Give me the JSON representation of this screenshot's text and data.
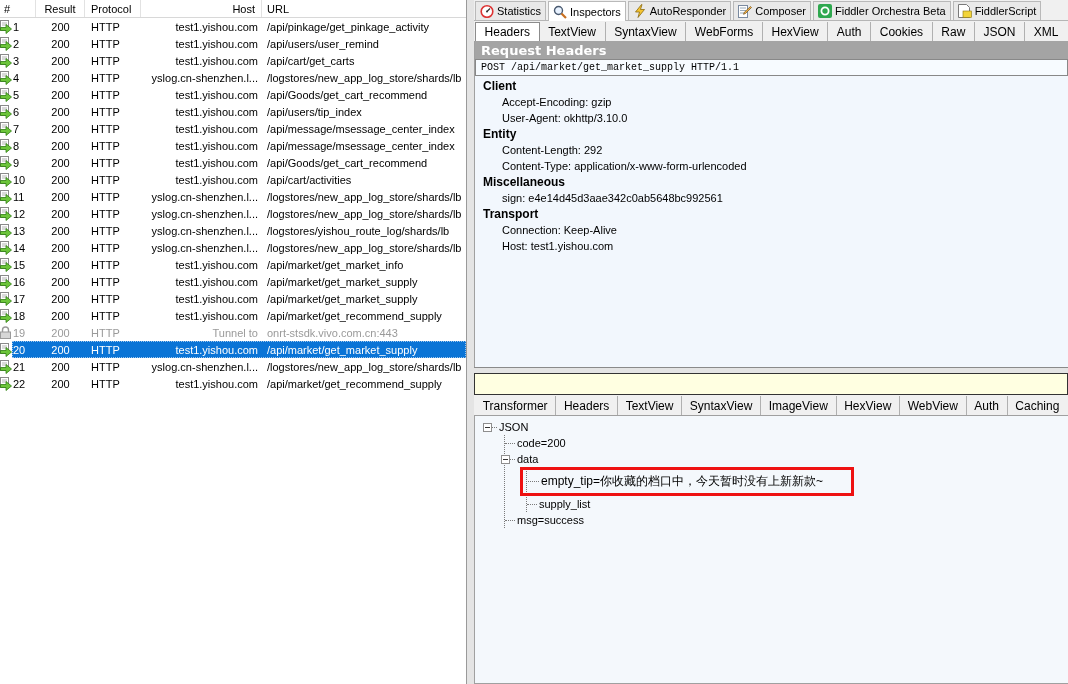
{
  "sessions": {
    "columns": [
      "#",
      "Result",
      "Protocol",
      "Host",
      "URL"
    ],
    "rows": [
      {
        "number": "1",
        "result": "200",
        "protocol": "HTTP",
        "host": "test1.yishou.com",
        "url": "/api/pinkage/get_pinkage_activity",
        "kind": "response",
        "selected": false
      },
      {
        "number": "2",
        "result": "200",
        "protocol": "HTTP",
        "host": "test1.yishou.com",
        "url": "/api/users/user_remind",
        "kind": "response",
        "selected": false
      },
      {
        "number": "3",
        "result": "200",
        "protocol": "HTTP",
        "host": "test1.yishou.com",
        "url": "/api/cart/get_carts",
        "kind": "response",
        "selected": false
      },
      {
        "number": "4",
        "result": "200",
        "protocol": "HTTP",
        "host": "yslog.cn-shenzhen.l...",
        "url": "/logstores/new_app_log_store/shards/lb",
        "kind": "response",
        "selected": false
      },
      {
        "number": "5",
        "result": "200",
        "protocol": "HTTP",
        "host": "test1.yishou.com",
        "url": "/api/Goods/get_cart_recommend",
        "kind": "response",
        "selected": false
      },
      {
        "number": "6",
        "result": "200",
        "protocol": "HTTP",
        "host": "test1.yishou.com",
        "url": "/api/users/tip_index",
        "kind": "response",
        "selected": false
      },
      {
        "number": "7",
        "result": "200",
        "protocol": "HTTP",
        "host": "test1.yishou.com",
        "url": "/api/message/msessage_center_index",
        "kind": "response",
        "selected": false
      },
      {
        "number": "8",
        "result": "200",
        "protocol": "HTTP",
        "host": "test1.yishou.com",
        "url": "/api/message/msessage_center_index",
        "kind": "response",
        "selected": false
      },
      {
        "number": "9",
        "result": "200",
        "protocol": "HTTP",
        "host": "test1.yishou.com",
        "url": "/api/Goods/get_cart_recommend",
        "kind": "response",
        "selected": false
      },
      {
        "number": "10",
        "result": "200",
        "protocol": "HTTP",
        "host": "test1.yishou.com",
        "url": "/api/cart/activities",
        "kind": "response",
        "selected": false
      },
      {
        "number": "11",
        "result": "200",
        "protocol": "HTTP",
        "host": "yslog.cn-shenzhen.l...",
        "url": "/logstores/new_app_log_store/shards/lb",
        "kind": "response",
        "selected": false
      },
      {
        "number": "12",
        "result": "200",
        "protocol": "HTTP",
        "host": "yslog.cn-shenzhen.l...",
        "url": "/logstores/new_app_log_store/shards/lb",
        "kind": "response",
        "selected": false
      },
      {
        "number": "13",
        "result": "200",
        "protocol": "HTTP",
        "host": "yslog.cn-shenzhen.l...",
        "url": "/logstores/yishou_route_log/shards/lb",
        "kind": "response",
        "selected": false
      },
      {
        "number": "14",
        "result": "200",
        "protocol": "HTTP",
        "host": "yslog.cn-shenzhen.l...",
        "url": "/logstores/new_app_log_store/shards/lb",
        "kind": "response",
        "selected": false
      },
      {
        "number": "15",
        "result": "200",
        "protocol": "HTTP",
        "host": "test1.yishou.com",
        "url": "/api/market/get_market_info",
        "kind": "response",
        "selected": false
      },
      {
        "number": "16",
        "result": "200",
        "protocol": "HTTP",
        "host": "test1.yishou.com",
        "url": "/api/market/get_market_supply",
        "kind": "response",
        "selected": false
      },
      {
        "number": "17",
        "result": "200",
        "protocol": "HTTP",
        "host": "test1.yishou.com",
        "url": "/api/market/get_market_supply",
        "kind": "response",
        "selected": false
      },
      {
        "number": "18",
        "result": "200",
        "protocol": "HTTP",
        "host": "test1.yishou.com",
        "url": "/api/market/get_recommend_supply",
        "kind": "response",
        "selected": false
      },
      {
        "number": "19",
        "result": "200",
        "protocol": "HTTP",
        "host": "Tunnel to",
        "url": "onrt-stsdk.vivo.com.cn:443",
        "kind": "tunnel",
        "selected": false
      },
      {
        "number": "20",
        "result": "200",
        "protocol": "HTTP",
        "host": "test1.yishou.com",
        "url": "/api/market/get_market_supply",
        "kind": "response",
        "selected": true
      },
      {
        "number": "21",
        "result": "200",
        "protocol": "HTTP",
        "host": "yslog.cn-shenzhen.l...",
        "url": "/logstores/new_app_log_store/shards/lb",
        "kind": "response",
        "selected": false
      },
      {
        "number": "22",
        "result": "200",
        "protocol": "HTTP",
        "host": "test1.yishou.com",
        "url": "/api/market/get_recommend_supply",
        "kind": "response",
        "selected": false
      }
    ]
  },
  "inspector": {
    "tabs": [
      {
        "label": "Statistics",
        "selected": false
      },
      {
        "label": "Inspectors",
        "selected": true
      },
      {
        "label": "AutoResponder",
        "selected": false
      },
      {
        "label": "Composer",
        "selected": false
      },
      {
        "label": "Fiddler Orchestra Beta",
        "selected": false
      },
      {
        "label": "FiddlerScript",
        "selected": false
      }
    ],
    "request": {
      "tabs": [
        {
          "label": "Headers",
          "selected": true
        },
        {
          "label": "TextView",
          "selected": false
        },
        {
          "label": "SyntaxView",
          "selected": false
        },
        {
          "label": "WebForms",
          "selected": false
        },
        {
          "label": "HexView",
          "selected": false
        },
        {
          "label": "Auth",
          "selected": false
        },
        {
          "label": "Cookies",
          "selected": false
        },
        {
          "label": "Raw",
          "selected": false
        },
        {
          "label": "JSON",
          "selected": false
        },
        {
          "label": "XML",
          "selected": false
        }
      ],
      "title": "Request Headers",
      "request_line": "POST /api/market/get_market_supply HTTP/1.1",
      "groups": [
        {
          "name": "Client",
          "headers": [
            "Accept-Encoding: gzip",
            "User-Agent: okhttp/3.10.0"
          ]
        },
        {
          "name": "Entity",
          "headers": [
            "Content-Length: 292",
            "Content-Type: application/x-www-form-urlencoded"
          ]
        },
        {
          "name": "Miscellaneous",
          "headers": [
            "sign: e4e14d45d3aae342c0ab5648bc992561"
          ]
        },
        {
          "name": "Transport",
          "headers": [
            "Connection: Keep-Alive",
            "Host: test1.yishou.com"
          ]
        }
      ]
    },
    "response": {
      "tabs": [
        {
          "label": "Transformer",
          "selected": false
        },
        {
          "label": "Headers",
          "selected": false
        },
        {
          "label": "TextView",
          "selected": false
        },
        {
          "label": "SyntaxView",
          "selected": false
        },
        {
          "label": "ImageView",
          "selected": false
        },
        {
          "label": "HexView",
          "selected": false
        },
        {
          "label": "WebView",
          "selected": false
        },
        {
          "label": "Auth",
          "selected": false
        },
        {
          "label": "Caching",
          "selected": false
        }
      ],
      "tree": [
        {
          "label": "JSON",
          "expanded": true,
          "highlighted": false,
          "children": [
            {
              "label": "code=200",
              "highlighted": false
            },
            {
              "label": "data",
              "expanded": true,
              "highlighted": false,
              "children": [
                {
                  "label": "empty_tip=你收藏的档口中，今天暂时没有上新新款~",
                  "highlighted": true
                },
                {
                  "label": "supply_list",
                  "highlighted": false
                }
              ]
            },
            {
              "label": "msg=success",
              "highlighted": false
            }
          ]
        }
      ]
    }
  }
}
